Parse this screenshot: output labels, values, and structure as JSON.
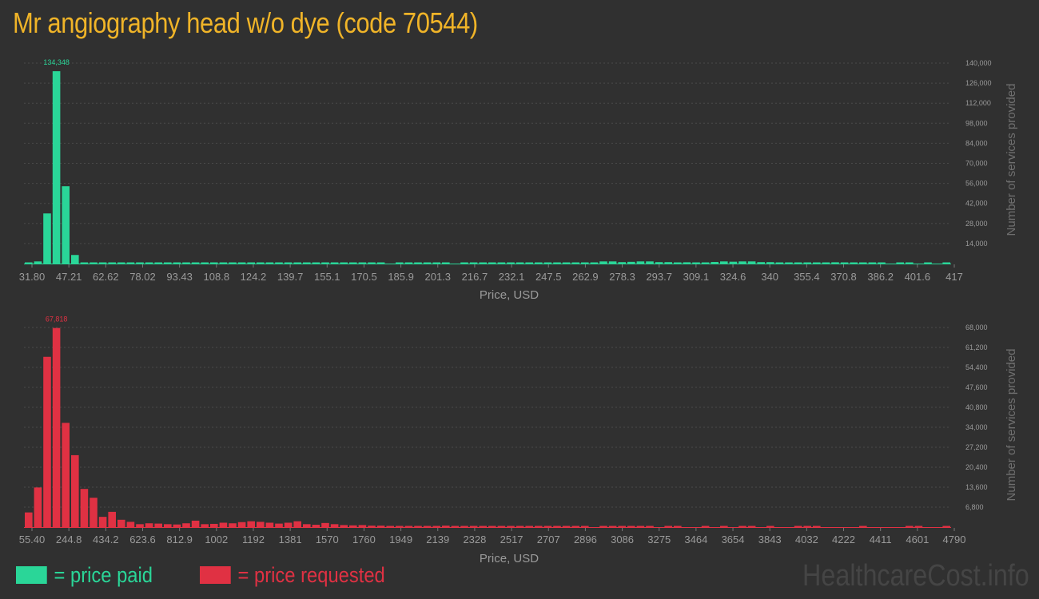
{
  "title": "Mr angiography head w/o dye (code 70544)",
  "colors": {
    "paid": "#2ad698",
    "requested": "#e03143",
    "title": "#f0b428"
  },
  "legend": {
    "paid": "= price paid",
    "requested": "= price requested"
  },
  "watermark": "HealthcareCost.info",
  "chart_data": [
    {
      "type": "bar",
      "series_key": "paid",
      "xlabel": "Price, USD",
      "ylabel": "Number of services provided",
      "ylim": [
        0,
        140000
      ],
      "yticks": [
        14000,
        28000,
        42000,
        56000,
        70000,
        84000,
        98000,
        112000,
        126000,
        140000
      ],
      "ytick_labels": [
        "14,000",
        "28,000",
        "42,000",
        "56,000",
        "70,000",
        "84,000",
        "98,000",
        "112,000",
        "126,000",
        "140,000"
      ],
      "xticks": [
        "31.80",
        "47.21",
        "62.62",
        "78.02",
        "93.43",
        "108.8",
        "124.2",
        "139.7",
        "155.1",
        "170.5",
        "185.9",
        "201.3",
        "216.7",
        "232.1",
        "247.5",
        "262.9",
        "278.3",
        "293.7",
        "309.1",
        "324.6",
        "340",
        "355.4",
        "370.8",
        "386.2",
        "401.6",
        "417"
      ],
      "peak_label": "134,348",
      "grid": true,
      "values": [
        300,
        1500,
        35000,
        134348,
        54000,
        6000,
        400,
        300,
        250,
        200,
        200,
        200,
        180,
        180,
        160,
        160,
        150,
        150,
        150,
        140,
        140,
        140,
        130,
        130,
        130,
        130,
        120,
        120,
        120,
        120,
        120,
        120,
        120,
        110,
        110,
        110,
        110,
        100,
        100,
        0,
        100,
        100,
        100,
        100,
        100,
        100,
        0,
        100,
        100,
        100,
        100,
        100,
        100,
        100,
        500,
        500,
        600,
        600,
        300,
        300,
        300,
        500,
        1500,
        1500,
        1000,
        1200,
        1500,
        1500,
        1000,
        1000,
        800,
        900,
        800,
        800,
        1100,
        1500,
        1300,
        1500,
        1500,
        1000,
        1000,
        800,
        800,
        700,
        700,
        700,
        800,
        900,
        700,
        800,
        700,
        700,
        500,
        0,
        200,
        200,
        0,
        100,
        0,
        150
      ]
    },
    {
      "type": "bar",
      "series_key": "requested",
      "xlabel": "Price, USD",
      "ylabel": "Number of services provided",
      "ylim": [
        0,
        68000
      ],
      "yticks": [
        6800,
        13600,
        20400,
        27200,
        34000,
        40800,
        47600,
        54400,
        61200,
        68000
      ],
      "ytick_labels": [
        "6,800",
        "13,600",
        "20,400",
        "27,200",
        "34,000",
        "40,800",
        "47,600",
        "54,400",
        "61,200",
        "68,000"
      ],
      "xticks": [
        "55.40",
        "244.8",
        "434.2",
        "623.6",
        "812.9",
        "1002",
        "1192",
        "1381",
        "1570",
        "1760",
        "1949",
        "2139",
        "2328",
        "2517",
        "2707",
        "2896",
        "3086",
        "3275",
        "3464",
        "3654",
        "3843",
        "4032",
        "4222",
        "4411",
        "4601",
        "4790"
      ],
      "peak_label": "67,818",
      "grid": true,
      "values": [
        5000,
        13500,
        58000,
        67818,
        35500,
        24500,
        13000,
        10000,
        3500,
        5200,
        2500,
        1800,
        1000,
        1300,
        1200,
        1000,
        900,
        1300,
        2200,
        1000,
        1100,
        1500,
        1300,
        1700,
        2000,
        1800,
        1500,
        1200,
        1500,
        2000,
        1000,
        800,
        1400,
        1000,
        700,
        600,
        700,
        500,
        500,
        300,
        400,
        300,
        300,
        200,
        300,
        500,
        300,
        400,
        300,
        200,
        200,
        150,
        150,
        150,
        150,
        150,
        120,
        120,
        120,
        100,
        100,
        0,
        100,
        120,
        120,
        100,
        100,
        120,
        0,
        100,
        100,
        0,
        0,
        150,
        0,
        150,
        0,
        150,
        150,
        0,
        150,
        0,
        0,
        150,
        150,
        150,
        0,
        0,
        0,
        0,
        150,
        0,
        0,
        0,
        0,
        150,
        150,
        0,
        0,
        150
      ]
    }
  ]
}
